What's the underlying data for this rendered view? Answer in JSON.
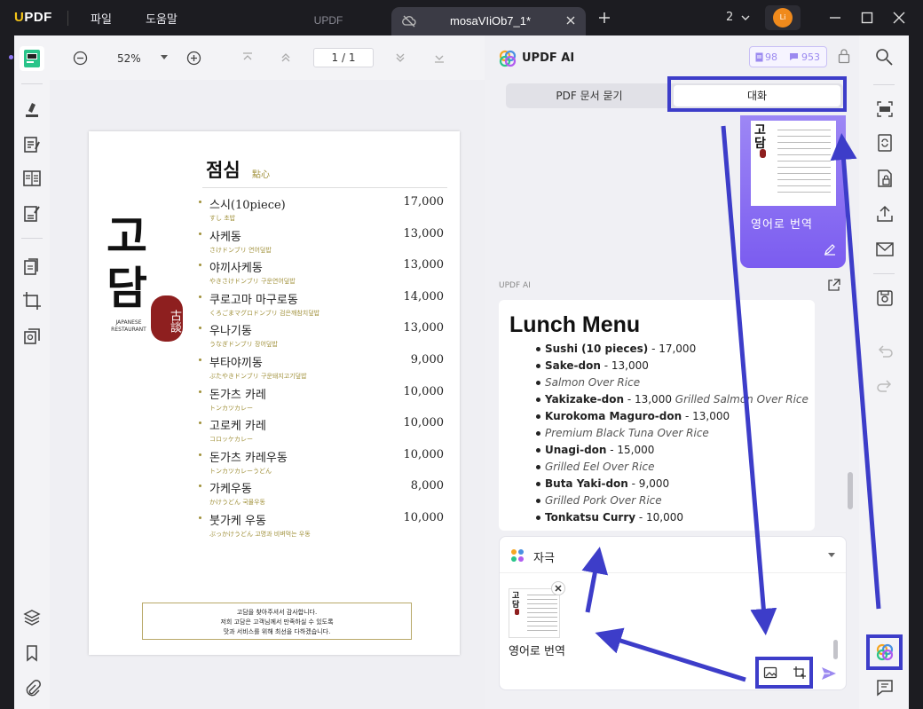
{
  "titlebar": {
    "logo": "UPDF",
    "menu_file": "파일",
    "menu_help": "도움말",
    "tab_inactive": "UPDF",
    "tab_active": "mosaVIiOb7_1*",
    "window_count": "2",
    "avatar": "Li"
  },
  "toolbar": {
    "zoom": "52%",
    "page_current": "1",
    "page_sep": "/",
    "page_total": "1"
  },
  "menu_page": {
    "title": "점심",
    "title_sub": "點心",
    "restaurant_big": [
      "고",
      "담"
    ],
    "restaurant_en1": "JAPANESE",
    "restaurant_en2": "RESTAURANT",
    "seal": "古談",
    "items": [
      {
        "name": "스시(10piece)",
        "sub": "すし 초밥",
        "price": "17,000"
      },
      {
        "name": "사케동",
        "sub": "さけドンブリ 연어덮밥",
        "price": "13,000"
      },
      {
        "name": "야끼사케동",
        "sub": "やきさけドンブリ 구운연어덮밥",
        "price": "13,000"
      },
      {
        "name": "쿠로고마 마구로동",
        "sub": "くろごまマグロドンブリ 검은깨참치덮밥",
        "price": "14,000"
      },
      {
        "name": "우나기동",
        "sub": "うなぎドンブリ 장어덮밥",
        "price": "13,000"
      },
      {
        "name": "부타야끼동",
        "sub": "ぶたやきドンブリ 구운돼지고기덮밥",
        "price": "9,000"
      },
      {
        "name": "돈가츠 카레",
        "sub": "トンカツカレー",
        "price": "10,000"
      },
      {
        "name": "고로케 카레",
        "sub": "コロッケカレー",
        "price": "10,000"
      },
      {
        "name": "돈가츠 카레우동",
        "sub": "トンカツカレーうどん",
        "price": "10,000"
      },
      {
        "name": "가케우동",
        "sub": "かけうどん 국물우동",
        "price": "8,000"
      },
      {
        "name": "붓가케 우동",
        "sub": "ぶっかけうどん 고명과 비벼먹는 우동",
        "price": "10,000"
      }
    ],
    "footer_lines": [
      "고담을 찾아주셔서 감사합니다.",
      "저희 고담은 고객님께서 만족하실 수 있도록",
      "맛과 서비스를 위해 최선을 다하겠습니다."
    ]
  },
  "ai": {
    "title": "UPDF AI",
    "credit_a": "98",
    "credit_b": "953",
    "tab_ask": "PDF 문서 묻기",
    "tab_chat": "대화",
    "user_msg": "영어로 번역",
    "bot_label": "UPDF AI",
    "answer_title": "Lunch Menu",
    "answer_lines": [
      {
        "b": "Sushi (10 pieces)",
        "r": " - 17,000",
        "i": ""
      },
      {
        "b": "Sake-don",
        "r": " - 13,000",
        "i": ""
      },
      {
        "b": "",
        "r": "",
        "i": "Salmon Over Rice"
      },
      {
        "b": "Yakizake-don",
        "r": " - 13,000 ",
        "i": "Grilled Salmon Over Rice"
      },
      {
        "b": "Kurokoma Maguro-don",
        "r": " - 13,000",
        "i": ""
      },
      {
        "b": "",
        "r": "",
        "i": "Premium Black Tuna Over Rice"
      },
      {
        "b": "Unagi-don",
        "r": " - 15,000",
        "i": ""
      },
      {
        "b": "",
        "r": "",
        "i": "Grilled Eel Over Rice"
      },
      {
        "b": "Buta Yaki-don",
        "r": " - 9,000",
        "i": ""
      },
      {
        "b": "",
        "r": "",
        "i": "Grilled Pork Over Rice"
      },
      {
        "b": "Tonkatsu Curry",
        "r": " - 10,000",
        "i": ""
      }
    ],
    "mode_label": "자극",
    "input_text": "영어로 번역"
  },
  "colors": {
    "accent": "#7b5cf0",
    "annotation": "#3d3dc9",
    "chat_bubble_top": "#9d87f5",
    "chat_bubble_bottom": "#7b5cf0"
  }
}
